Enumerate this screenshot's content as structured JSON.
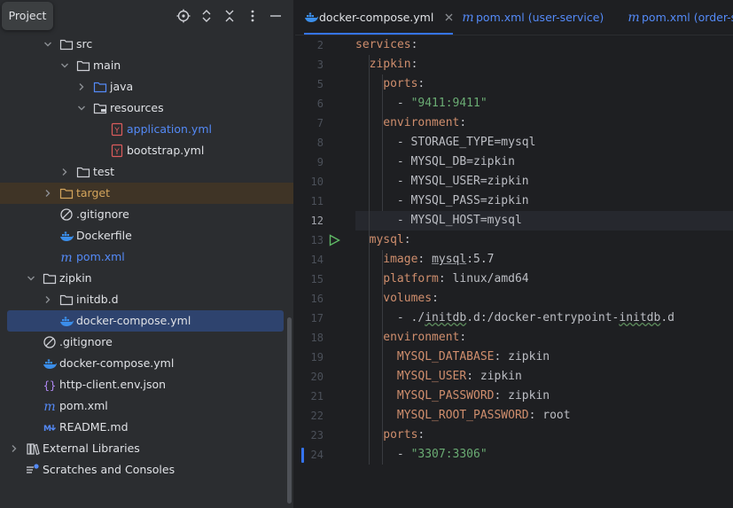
{
  "project_panel": {
    "title": "Project",
    "header_icons": [
      "locate-icon",
      "expand-icon",
      "collapse-icon",
      "more-icon",
      "minimize-icon"
    ],
    "tree": [
      {
        "label": "src",
        "icon": "folder-icon",
        "chevron": "open",
        "depth": 2
      },
      {
        "label": "main",
        "icon": "folder-icon",
        "chevron": "open",
        "depth": 3
      },
      {
        "label": "java",
        "icon": "source-folder-icon",
        "chevron": "closed",
        "depth": 4
      },
      {
        "label": "resources",
        "icon": "resources-folder-icon",
        "chevron": "open",
        "depth": 4
      },
      {
        "label": "application.yml",
        "icon": "yaml-file-icon",
        "chevron": "none",
        "depth": 5,
        "color": "blue"
      },
      {
        "label": "bootstrap.yml",
        "icon": "yaml-file-icon",
        "chevron": "none",
        "depth": 5
      },
      {
        "label": "test",
        "icon": "folder-icon",
        "chevron": "closed",
        "depth": 3
      },
      {
        "label": "target",
        "icon": "excluded-folder-icon",
        "chevron": "closed",
        "depth": 2,
        "color": "orange",
        "excluded": true
      },
      {
        "label": ".gitignore",
        "icon": "ignore-file-icon",
        "chevron": "none",
        "depth": 2
      },
      {
        "label": "Dockerfile",
        "icon": "docker-icon",
        "chevron": "none",
        "depth": 2
      },
      {
        "label": "pom.xml",
        "icon": "maven-icon",
        "chevron": "none",
        "depth": 2,
        "color": "blue"
      },
      {
        "label": "zipkin",
        "icon": "folder-icon",
        "chevron": "open",
        "depth": 1
      },
      {
        "label": "initdb.d",
        "icon": "folder-icon",
        "chevron": "closed",
        "depth": 2
      },
      {
        "label": "docker-compose.yml",
        "icon": "docker-icon",
        "chevron": "none",
        "depth": 2,
        "selected": true
      },
      {
        "label": ".gitignore",
        "icon": "ignore-file-icon",
        "chevron": "none",
        "depth": 1
      },
      {
        "label": "docker-compose.yml",
        "icon": "docker-icon",
        "chevron": "none",
        "depth": 1
      },
      {
        "label": "http-client.env.json",
        "icon": "json-file-icon",
        "chevron": "none",
        "depth": 1
      },
      {
        "label": "pom.xml",
        "icon": "maven-icon",
        "chevron": "none",
        "depth": 1
      },
      {
        "label": "README.md",
        "icon": "markdown-icon",
        "chevron": "none",
        "depth": 1
      },
      {
        "label": "External Libraries",
        "icon": "library-icon",
        "chevron": "closed",
        "depth": 0
      },
      {
        "label": "Scratches and Consoles",
        "icon": "scratches-icon",
        "chevron": "none",
        "depth": 0
      }
    ]
  },
  "editor": {
    "tabs": [
      {
        "label": "docker-compose.yml",
        "sub": "",
        "icon": "docker-icon",
        "active": true,
        "closable": true
      },
      {
        "label": "pom.xml",
        "sub": " (user-service)",
        "icon": "maven-icon",
        "active": false,
        "closable": false
      },
      {
        "label": "pom.xml",
        "sub": " (order-se",
        "icon": "maven-icon",
        "active": false,
        "closable": false
      }
    ],
    "current_line": "12",
    "lines": [
      {
        "n": "2",
        "indent": 0,
        "parts": [
          [
            "k",
            "services"
          ],
          [
            "p",
            ":"
          ]
        ]
      },
      {
        "n": "3",
        "indent": 1,
        "parts": [
          [
            "k",
            "zipkin"
          ],
          [
            "p",
            ":"
          ]
        ]
      },
      {
        "n": "5",
        "indent": 2,
        "parts": [
          [
            "k",
            "ports"
          ],
          [
            "p",
            ":"
          ]
        ]
      },
      {
        "n": "6",
        "indent": 3,
        "parts": [
          [
            "p",
            "- "
          ],
          [
            "s",
            "\"9411:9411\""
          ]
        ]
      },
      {
        "n": "7",
        "indent": 2,
        "parts": [
          [
            "k",
            "environment"
          ],
          [
            "p",
            ":"
          ]
        ]
      },
      {
        "n": "8",
        "indent": 3,
        "parts": [
          [
            "p",
            "- STORAGE_TYPE=mysql"
          ]
        ]
      },
      {
        "n": "9",
        "indent": 3,
        "parts": [
          [
            "p",
            "- MYSQL_DB=zipkin"
          ]
        ]
      },
      {
        "n": "10",
        "indent": 3,
        "parts": [
          [
            "p",
            "- MYSQL_USER=zipkin"
          ]
        ]
      },
      {
        "n": "11",
        "indent": 3,
        "parts": [
          [
            "p",
            "- MYSQL_PASS=zipkin"
          ]
        ]
      },
      {
        "n": "12",
        "indent": 3,
        "parts": [
          [
            "p",
            "- MYSQL_HOST=mysql"
          ]
        ]
      },
      {
        "n": "13",
        "indent": 1,
        "parts": [
          [
            "k",
            "mysql"
          ],
          [
            "p",
            ":"
          ]
        ],
        "run": true
      },
      {
        "n": "14",
        "indent": 2,
        "parts": [
          [
            "k",
            "image"
          ],
          [
            "p",
            ": "
          ],
          [
            "u",
            "mysql"
          ],
          [
            "p",
            ":5.7"
          ]
        ]
      },
      {
        "n": "15",
        "indent": 2,
        "parts": [
          [
            "k",
            "platform"
          ],
          [
            "p",
            ": linux/amd64"
          ]
        ]
      },
      {
        "n": "16",
        "indent": 2,
        "parts": [
          [
            "k",
            "volumes"
          ],
          [
            "p",
            ":"
          ]
        ]
      },
      {
        "n": "17",
        "indent": 3,
        "parts": [
          [
            "p",
            "- ./"
          ],
          [
            "w",
            "initdb"
          ],
          [
            "p",
            ".d:/docker-entrypoint-"
          ],
          [
            "w",
            "initdb"
          ],
          [
            "p",
            ".d"
          ]
        ]
      },
      {
        "n": "18",
        "indent": 2,
        "parts": [
          [
            "k",
            "environment"
          ],
          [
            "p",
            ":"
          ]
        ]
      },
      {
        "n": "19",
        "indent": 3,
        "parts": [
          [
            "k",
            "MYSQL_DATABASE"
          ],
          [
            "p",
            ": zipkin"
          ]
        ]
      },
      {
        "n": "20",
        "indent": 3,
        "parts": [
          [
            "k",
            "MYSQL_USER"
          ],
          [
            "p",
            ": zipkin"
          ]
        ]
      },
      {
        "n": "21",
        "indent": 3,
        "parts": [
          [
            "k",
            "MYSQL_PASSWORD"
          ],
          [
            "p",
            ": zipkin"
          ]
        ]
      },
      {
        "n": "22",
        "indent": 3,
        "parts": [
          [
            "k",
            "MYSQL_ROOT_PASSWORD"
          ],
          [
            "p",
            ": root"
          ]
        ]
      },
      {
        "n": "23",
        "indent": 2,
        "parts": [
          [
            "k",
            "ports"
          ],
          [
            "p",
            ":"
          ]
        ]
      },
      {
        "n": "24",
        "indent": 3,
        "parts": [
          [
            "p",
            "- "
          ],
          [
            "s",
            "\"3307:3306\""
          ]
        ],
        "changed": true
      }
    ]
  },
  "colors": {
    "panel_bg": "#2b2d30",
    "editor_bg": "#1e1f22",
    "selection": "#2e436e",
    "accent": "#3574f0",
    "key": "#cf8e6d",
    "string": "#6aab73",
    "link_blue": "#548af7",
    "excluded": "#d4a55c"
  }
}
